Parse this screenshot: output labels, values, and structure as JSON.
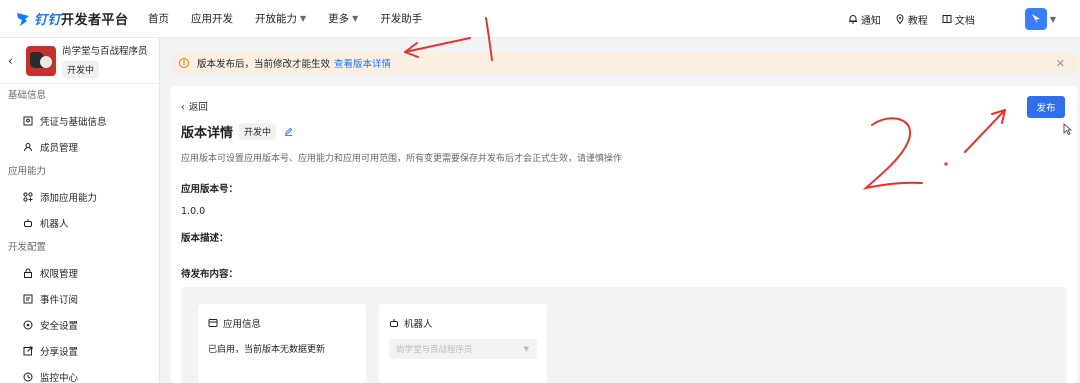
{
  "header": {
    "logo_prefix": "钉钉",
    "logo_suffix": "开发者平台",
    "nav": [
      {
        "label": "首页"
      },
      {
        "label": "应用开发"
      },
      {
        "label": "开放能力"
      },
      {
        "label": "更多"
      },
      {
        "label": "开发助手"
      }
    ],
    "notify_label": "通知",
    "tutorial_label": "教程",
    "docs_label": "文档"
  },
  "sidebar": {
    "app_name": "尚学堂与百战程序员",
    "app_status": "开发中",
    "sections": [
      {
        "title": "基础信息",
        "items": [
          {
            "label": "凭证与基础信息",
            "icon": "credential-icon"
          },
          {
            "label": "成员管理",
            "icon": "user-icon"
          }
        ]
      },
      {
        "title": "应用能力",
        "items": [
          {
            "label": "添加应用能力",
            "icon": "grid-plus-icon"
          },
          {
            "label": "机器人",
            "icon": "robot-icon"
          }
        ]
      },
      {
        "title": "开发配置",
        "items": [
          {
            "label": "权限管理",
            "icon": "lock-icon"
          },
          {
            "label": "事件订阅",
            "icon": "event-icon"
          },
          {
            "label": "安全设置",
            "icon": "shield-icon"
          },
          {
            "label": "分享设置",
            "icon": "share-icon"
          },
          {
            "label": "监控中心",
            "icon": "monitor-icon"
          }
        ]
      }
    ]
  },
  "notice": {
    "text": "版本发布后，当前修改才能生效",
    "link": "查看版本详情"
  },
  "main": {
    "back_label": "返回",
    "title": "版本详情",
    "status": "开发中",
    "description": "应用版本可设置应用版本号、应用能力和应用可用范围，所有变更需要保存并发布后才会正式生效，请谨慎操作",
    "publish_label": "发布",
    "version_label": "应用版本号：",
    "version_value": "1.0.0",
    "version_desc_label": "版本描述：",
    "pending_label": "待发布内容：",
    "pending": {
      "app_info_title": "应用信息",
      "app_info_text": "已启用，当前版本无数据更新",
      "robot_title": "机器人",
      "robot_select": "尚学堂与百战程序员"
    }
  },
  "colors": {
    "accent": "#2f6fed",
    "notice_bg": "#fbefe2",
    "annotation": "#e8332b"
  }
}
